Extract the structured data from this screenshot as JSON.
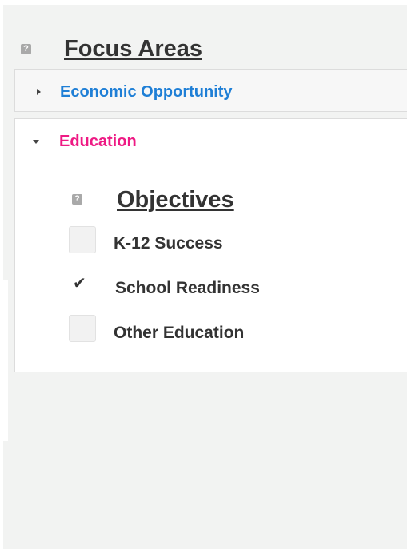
{
  "focus_areas": {
    "help_icon": "?",
    "heading": "Focus Areas",
    "items": [
      {
        "label": "Economic Opportunity",
        "state": "collapsed",
        "color": "#1f7fd6"
      },
      {
        "label": "Education",
        "state": "expanded",
        "color": "#ee1a84",
        "objectives": {
          "help_icon": "?",
          "heading": "Objectives",
          "options": [
            {
              "label": "K-12 Success",
              "checked": false
            },
            {
              "label": "School Readiness",
              "checked": true,
              "check_glyph": "✔"
            },
            {
              "label": "Other Education",
              "checked": false
            }
          ]
        }
      }
    ]
  },
  "colors": {
    "panel_bg": "#f2f3f2",
    "border": "#dcdcdc",
    "text": "#333333",
    "help_icon_bg": "#a9a9a9"
  }
}
